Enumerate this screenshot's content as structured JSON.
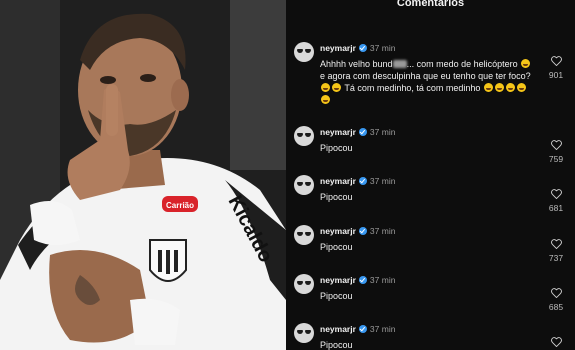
{
  "header": {
    "title": "Comentários"
  },
  "colors": {
    "panel_bg": "#0d0d0d",
    "verified": "#3897f0",
    "emoji": "#f5c518"
  },
  "comments": [
    {
      "username": "neymarjr",
      "time": "37 min",
      "text_parts": [
        "Ahhhh velho bund",
        "... com medo de helicóptero ",
        " e agora com desculpinha que eu tenho que ter foco? ",
        " Tá com medinho, tá com medinho "
      ],
      "likes": "901",
      "liked_icon": "heart-outline-icon"
    },
    {
      "username": "neymarjr",
      "time": "37 min",
      "text": "Pipocou",
      "likes": "759"
    },
    {
      "username": "neymarjr",
      "time": "37 min",
      "text": "Pipocou",
      "likes": "681"
    },
    {
      "username": "neymarjr",
      "time": "37 min",
      "text": "Pipocou",
      "likes": "737"
    },
    {
      "username": "neymarjr",
      "time": "37 min",
      "text": "Pipocou",
      "likes": "685"
    },
    {
      "username": "neymarjr",
      "time": "37 min",
      "text": "Pipocou",
      "likes": ""
    }
  ],
  "photo": {
    "jersey_text": "Kicaldo",
    "sponsor": "Carrião"
  }
}
